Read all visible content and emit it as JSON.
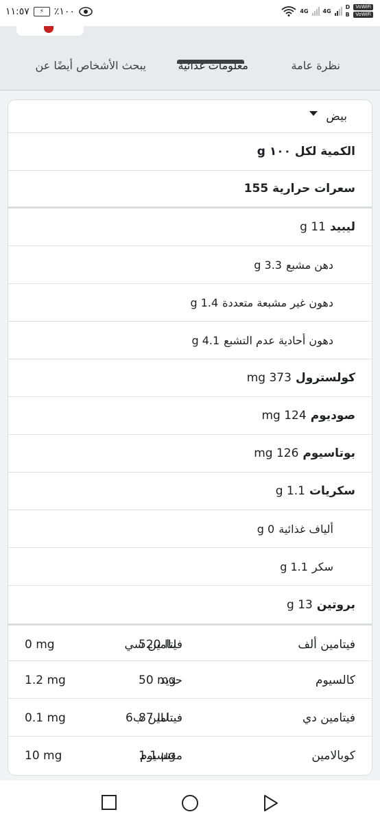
{
  "status_bar": {
    "time": "١١:٥٧",
    "battery": "٪١٠٠",
    "net_a": "4G",
    "net_b": "4G",
    "vowifi_top": "VoWiFi",
    "vowifi_bottom": "VoWiFi",
    "sim_top": "D",
    "sim_bottom": "B"
  },
  "tabs": [
    {
      "label": "نظرة عامة",
      "active": false
    },
    {
      "label": "معلومات غذائية",
      "active": true
    },
    {
      "label": "يبحث الأشخاص أيضًا عن",
      "active": false
    }
  ],
  "food_select": {
    "value": "بيض"
  },
  "nutrition": {
    "serving": "الكمية لكل ١٠٠ g",
    "calories": "سعرات حرارية 155",
    "rows": [
      {
        "name": "ليبيد",
        "value": "11 g",
        "level": "main"
      },
      {
        "name": "دهن مشبع",
        "value": "3.3 g",
        "level": "sub"
      },
      {
        "name": "دهون غير مشبعة متعددة",
        "value": "1.4 g",
        "level": "sub"
      },
      {
        "name": "دهون أحادية عدم التشبع",
        "value": "4.1 g",
        "level": "sub"
      },
      {
        "name": "كولسترول",
        "value": "373 mg",
        "level": "main"
      },
      {
        "name": "صوديوم",
        "value": "124 mg",
        "level": "main"
      },
      {
        "name": "بوتاسيوم",
        "value": "126 mg",
        "level": "main"
      },
      {
        "name": "سكريات",
        "value": "1.1 g",
        "level": "main"
      },
      {
        "name": "ألياف غذائية",
        "value": "0 g",
        "level": "sub"
      },
      {
        "name": "سكر",
        "value": "1.1 g",
        "level": "sub"
      },
      {
        "name": "بروتين",
        "value": "13 g",
        "level": "main"
      }
    ],
    "vitamins": [
      {
        "name1": "فيتامين ألف",
        "value1": "520 IU",
        "name2": "فيتامين سي",
        "value2": "0 mg"
      },
      {
        "name1": "كالسيوم",
        "value1": "50 mg",
        "name2": "حديد",
        "value2": "1.2 mg"
      },
      {
        "name1": "فيتامين دي",
        "value1": "87 IU",
        "name2": "فيتامين ب6",
        "value2": "0.1 mg"
      },
      {
        "name1": "كوبالامين",
        "value1": "1.1 µg",
        "name2": "مغنسيوم",
        "value2": "10 mg"
      }
    ]
  },
  "navbar": {
    "icons": [
      "recent-apps-icon",
      "home-icon",
      "back-icon"
    ]
  },
  "colors": {
    "accent": "#3c4043",
    "card_bg": "#ffffff",
    "page_bg": "#f1f3f4"
  }
}
